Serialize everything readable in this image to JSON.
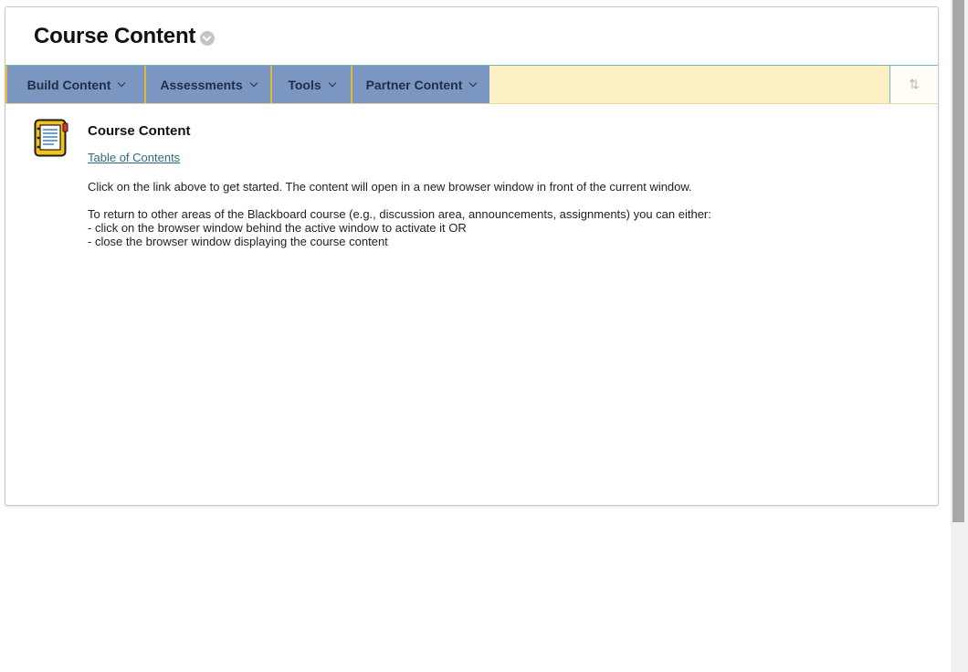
{
  "page": {
    "title": "Course Content"
  },
  "action_bar": {
    "menus": [
      {
        "label": "Build Content"
      },
      {
        "label": "Assessments"
      },
      {
        "label": "Tools"
      },
      {
        "label": "Partner Content"
      }
    ],
    "sort_icon": "reorder-arrows-icon",
    "sort_glyph": "⇅"
  },
  "content_item": {
    "icon": "content-folder-icon",
    "title": "Course Content",
    "link_text": "Table of Contents",
    "description": {
      "p1": "Click on the link above to get started. The content will open in a new browser window in front of the current window.",
      "p2_line1": "To return to other areas of the Blackboard course (e.g., discussion area, announcements, assignments) you can either:",
      "p2_line2": "- click on the browser window behind the active window to activate it OR",
      "p2_line3": "- close the browser window displaying the course content"
    }
  },
  "colors": {
    "menu_bg": "#7b96c1",
    "menu_divider": "#e0b73b",
    "bar_bg": "#fdefc4",
    "link": "#2b6a86"
  }
}
